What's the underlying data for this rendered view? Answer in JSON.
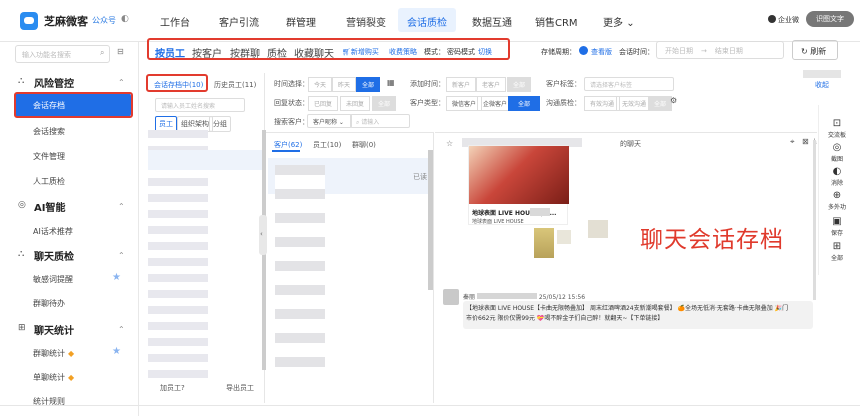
{
  "app": {
    "name": "芝麻微客",
    "official": "公众号"
  },
  "top_nav": [
    "工作台",
    "客户引流",
    "群管理",
    "营销裂变",
    "会话质检",
    "数据互通",
    "销售CRM",
    "更多"
  ],
  "top_nav_more_caret": "⌄",
  "top_user": "企业微",
  "top_pill": "识图文字",
  "sidebar": {
    "search_placeholder": "输入功能名搜索",
    "sections": [
      {
        "title": "风险管控",
        "items": [
          "会话存档",
          "会话搜索",
          "文件管理",
          "人工质检"
        ]
      },
      {
        "title": "AI智能",
        "items": [
          "AI话术推荐"
        ]
      },
      {
        "title": "聊天质检",
        "items": [
          "敏感词提醒",
          "群聊待办"
        ]
      },
      {
        "title": "聊天统计",
        "items": [
          "群聊统计",
          "单聊统计",
          "统计规则"
        ]
      }
    ]
  },
  "filter_tabs": [
    "按员工",
    "按客户",
    "按群聊",
    "质检",
    "收藏聊天"
  ],
  "filter_extra": {
    "new": "新增购买",
    "strategy": "收费策略",
    "mode_label": "模式：",
    "mode_value": "密码模式",
    "switch": "切换"
  },
  "storage_label": "存储周期：",
  "storage_value": "查看版",
  "session_time_label": "会话时间：",
  "date_start": "开始日期",
  "date_end": "结束日期",
  "refresh": "刷新",
  "collapse": "收起",
  "emp_tabs": [
    "会话存档中(10)",
    "历史员工(11)"
  ],
  "emp_search": "请输入员工姓名搜索",
  "emp_chips": [
    "员工",
    "组织架构",
    "分组"
  ],
  "emp_footer": {
    "add": "加员工?",
    "export": "导出员工"
  },
  "time_filter": {
    "label": "时间选择：",
    "options": [
      "今天",
      "昨天",
      "全部"
    ]
  },
  "add_time_label": "添加时间：",
  "add_time_options": [
    "新客户",
    "老客户",
    "全部"
  ],
  "customer_label_label": "客户标签：",
  "customer_label_placeholder": "请选择客户标签",
  "status_label": "回复状态：",
  "status_options": [
    "已回复",
    "未回复",
    "全部"
  ],
  "customer_type_label": "客户类型：",
  "customer_type_options": [
    "微信客户",
    "企微客户",
    "全部"
  ],
  "quality_label": "沟通质检：",
  "quality_options": [
    "有效沟通",
    "无效沟通",
    "全部"
  ],
  "search_customer_label": "搜索客户：",
  "search_customer_select": "客户昵称",
  "search_customer_placeholder": "请输入",
  "chat_tabs": [
    "客户(62)",
    "员工(10)",
    "群聊(0)"
  ],
  "chat_read": "已读",
  "chat_header_right": "的聊天",
  "right_tools": [
    {
      "icon": "⊡",
      "label": "交流板"
    },
    {
      "icon": "◎",
      "label": "截图"
    },
    {
      "icon": "◐",
      "label": "消除"
    },
    {
      "icon": "⊕",
      "label": "多外功"
    },
    {
      "icon": "▣",
      "label": "保存"
    },
    {
      "icon": "⊞",
      "label": "全部"
    }
  ],
  "card": {
    "title": "地球表面 LIVE HOUSE | [ ...",
    "sub": "地球表面 LIVE HOUSE"
  },
  "overlay_label": "聊天会话存档",
  "message": {
    "name": "秦丽",
    "time": "25/05/12 15:56",
    "text1": "【地球表面 LIVE HOUSE【卡曲无限畅叠加】 周末红酒啤酒24支新潮喝套餐】 🍊全场无低消·无套路·卡曲无限叠加 🎉门",
    "text2": "市价662元 限价仅需99元 💝喝不醉金子们自己醉！就翻天~【下单链接】"
  }
}
